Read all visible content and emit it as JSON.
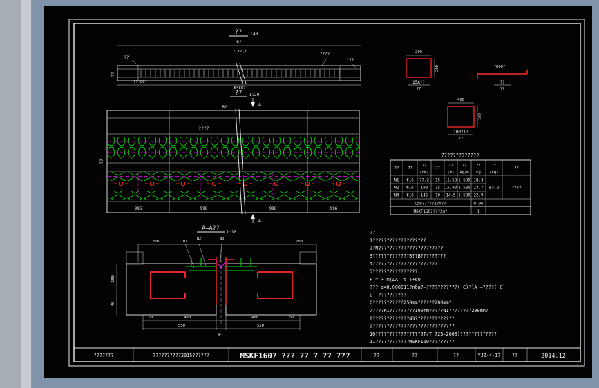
{
  "window": {
    "background": "#8193a8",
    "canvas": "#020202"
  },
  "colors": {
    "line": "#e8eef2",
    "green": "#00e000",
    "magenta": "#ff00ff",
    "red": "#ff2a2a",
    "hatch": "#cfe0e8"
  },
  "elevation": {
    "title": "??",
    "scale": "1:40",
    "label_b": "B?",
    "label_slope": "? ??(1",
    "label_left": "??",
    "label_right1": "????",
    "label_right2": "???",
    "dim_left": "??*80?",
    "dim_center": "B*80?",
    "side_label": "??"
  },
  "plan": {
    "title": "??",
    "scale": "1:20",
    "top_label": "????",
    "label_b": "B?",
    "mark_top": "A",
    "mark_bottom": "A",
    "dims_bottom": [
      "996",
      "998",
      "998",
      "996"
    ],
    "left_label": "??"
  },
  "section": {
    "title": "A—A??",
    "scale": "1:10",
    "dim_200_left": "200",
    "dim_200_right": "200",
    "bar_labels": [
      "N1",
      "N2",
      "N3"
    ],
    "dims_left": [
      "150",
      "40"
    ],
    "dims_bottom": [
      "50",
      "400",
      "400",
      "50"
    ],
    "dims_bottom2": [
      "550",
      "550"
    ],
    "label_f": "F"
  },
  "details": [
    {
      "dim_top": "200",
      "dim_right": "200",
      "label": "15A??",
      "sub": "??"
    },
    {
      "dim_top": "?000?",
      "label": "??",
      "sub": "??"
    },
    {
      "dim_top": "400",
      "dim_right": "100",
      "label": "100?1?",
      "sub": "??"
    }
  ],
  "table": {
    "title": "?????????????",
    "headers": [
      {
        "l1": "??",
        "l2": ""
      },
      {
        "l1": "??",
        "l2": ""
      },
      {
        "l1": "??",
        "l2": "(cm)"
      },
      {
        "l1": "??",
        "l2": ""
      },
      {
        "l1": "??",
        "l2": "(m)"
      },
      {
        "l1": "??",
        "l2": "kg/m"
      },
      {
        "l1": "??",
        "l2": "(kg)"
      },
      {
        "l1": "??",
        "l2": "(kg)"
      },
      {
        "l1": "??",
        "l2": ""
      }
    ],
    "rows": [
      [
        "N1",
        "Φ16",
        "77.2",
        "15",
        "11.58",
        "1.580",
        "18.3"
      ],
      [
        "N2",
        "Φ16",
        "190",
        "15",
        "15.00",
        "1.580",
        "23.7"
      ],
      [
        "N3",
        "Φ16",
        "145",
        "10",
        "14.5",
        "1.580",
        "22.9"
      ]
    ],
    "total": "64.9",
    "remark": "????",
    "extra_rows": [
      {
        "label": "C50?????2?m??",
        "value": "0.06"
      },
      {
        "label": "MSKF160????2m?",
        "value": "1"
      }
    ]
  },
  "notes": {
    "lines": [
      "??",
      "1???????????????????",
      "2?N2??????????????????????",
      "3?????????????B??B?????????",
      "4???????????????????????",
      "5????????????????:",
      "    F = ∞ m(ΔA —t )+60",
      "    ??? α=0.000011?nδα?—???????????( C)?lA —????( C)",
      "    L —??????????",
      "6???????????250mm??????200mm?",
      "7????N1?????????100mm?????N1????????200mm?",
      "8?????????????N3??????????????",
      "9?????????????????????????????",
      "10????????????????JT/T 723—2008)?????????????",
      "11????????????MSKF160?????????"
    ]
  },
  "titleblock": {
    "cells": [
      "???????",
      "??????????2015??????",
      "MSKF160? ??? ?? ? ?? ???",
      "??",
      "??",
      "??",
      "YJZ-4-17",
      "??",
      "2014.12"
    ]
  }
}
